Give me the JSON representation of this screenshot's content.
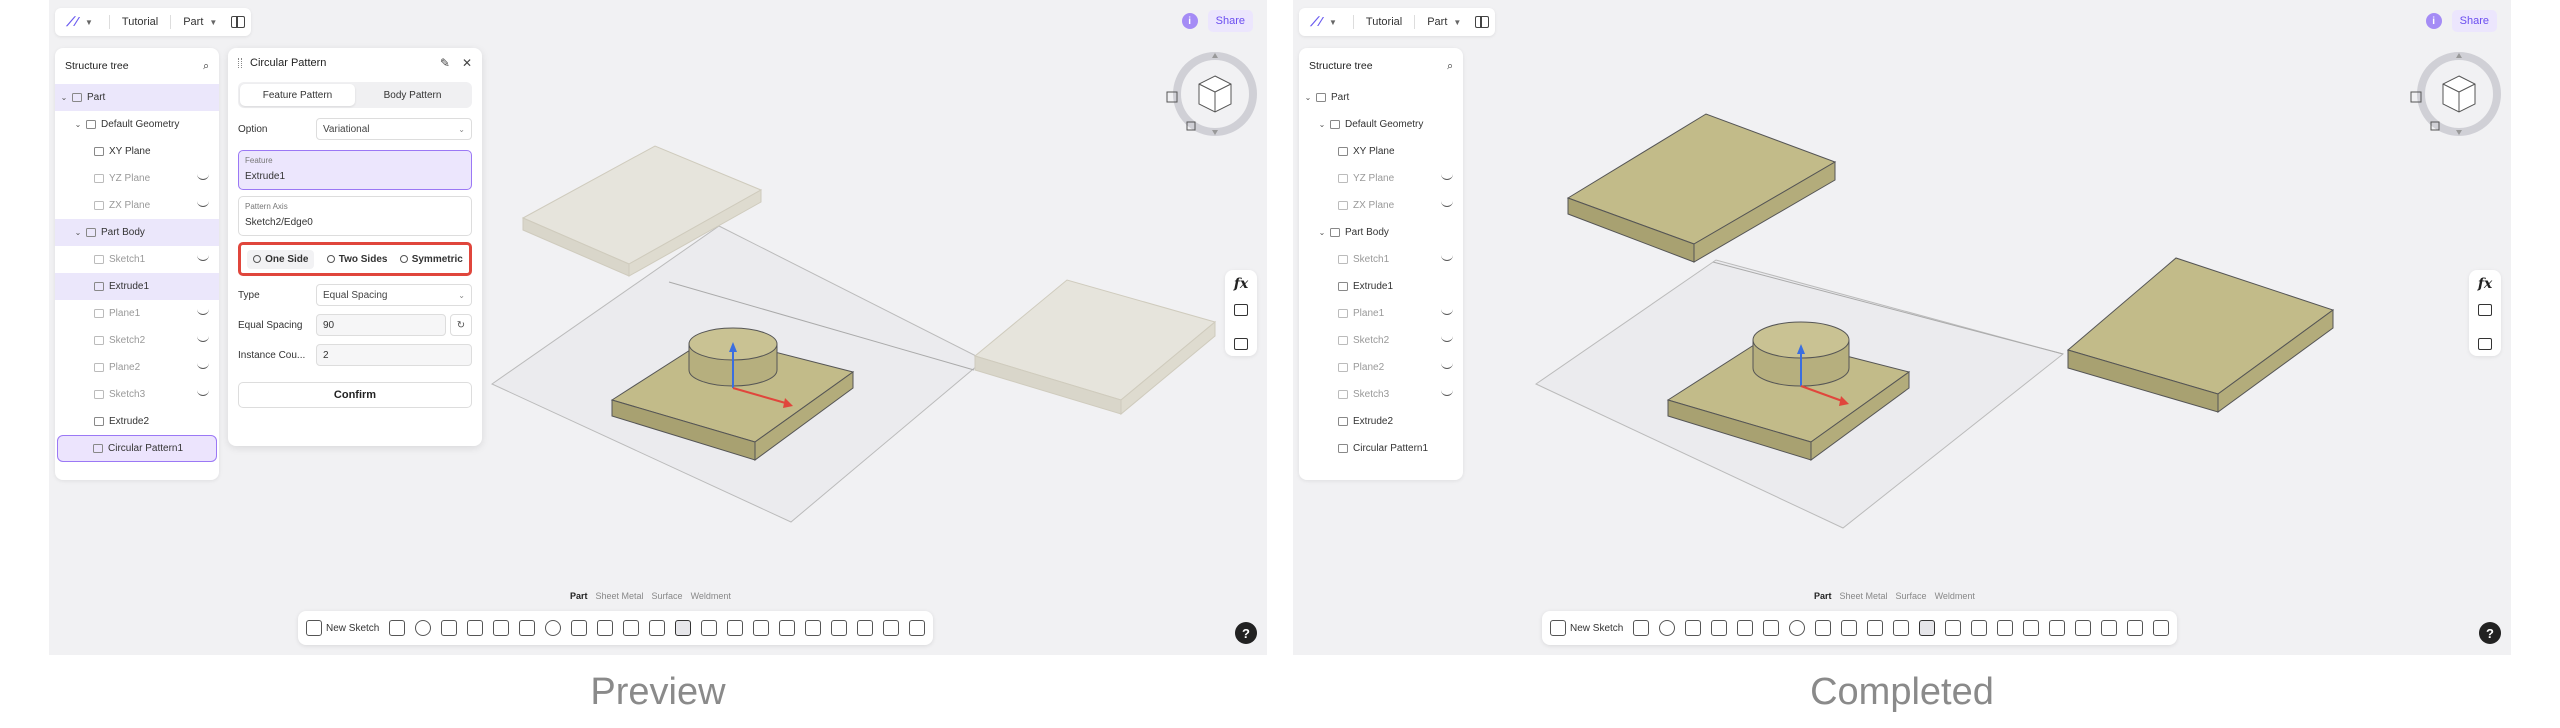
{
  "captions": {
    "left": "Preview",
    "right": "Completed"
  },
  "topbar": {
    "tutorial": "Tutorial",
    "part": "Part",
    "share": "Share",
    "info": "i"
  },
  "tree": {
    "title": "Structure tree",
    "items": [
      {
        "label": "Part"
      },
      {
        "label": "Default Geometry"
      },
      {
        "label": "XY Plane"
      },
      {
        "label": "YZ Plane"
      },
      {
        "label": "ZX Plane"
      },
      {
        "label": "Part Body"
      },
      {
        "label": "Sketch1"
      },
      {
        "label": "Extrude1"
      },
      {
        "label": "Plane1"
      },
      {
        "label": "Sketch2"
      },
      {
        "label": "Plane2"
      },
      {
        "label": "Sketch3"
      },
      {
        "label": "Extrude2"
      },
      {
        "label": "Circular Pattern1"
      }
    ]
  },
  "dialog": {
    "title": "Circular Pattern",
    "tab_feature": "Feature Pattern",
    "tab_body": "Body Pattern",
    "option_label": "Option",
    "option_value": "Variational",
    "feature_label": "Feature",
    "feature_value": "Extrude1",
    "axis_label": "Pattern Axis",
    "axis_value": "Sketch2/Edge0",
    "side_one": "One Side",
    "side_two": "Two Sides",
    "side_sym": "Symmetric",
    "type_label": "Type",
    "type_value": "Equal Spacing",
    "spacing_label": "Equal Spacing",
    "spacing_value": "90",
    "count_label": "Instance Cou...",
    "count_value": "2",
    "confirm": "Confirm"
  },
  "modes": {
    "part": "Part",
    "sheet": "Sheet Metal",
    "surface": "Surface",
    "weldment": "Weldment"
  },
  "toolbar": {
    "new_sketch": "New Sketch"
  },
  "right_tools": {
    "fx": "fx"
  },
  "help": "?",
  "colors": {
    "accent": "#9b78f5",
    "highlight_border": "#e0463c",
    "solid": "#bdb685"
  }
}
